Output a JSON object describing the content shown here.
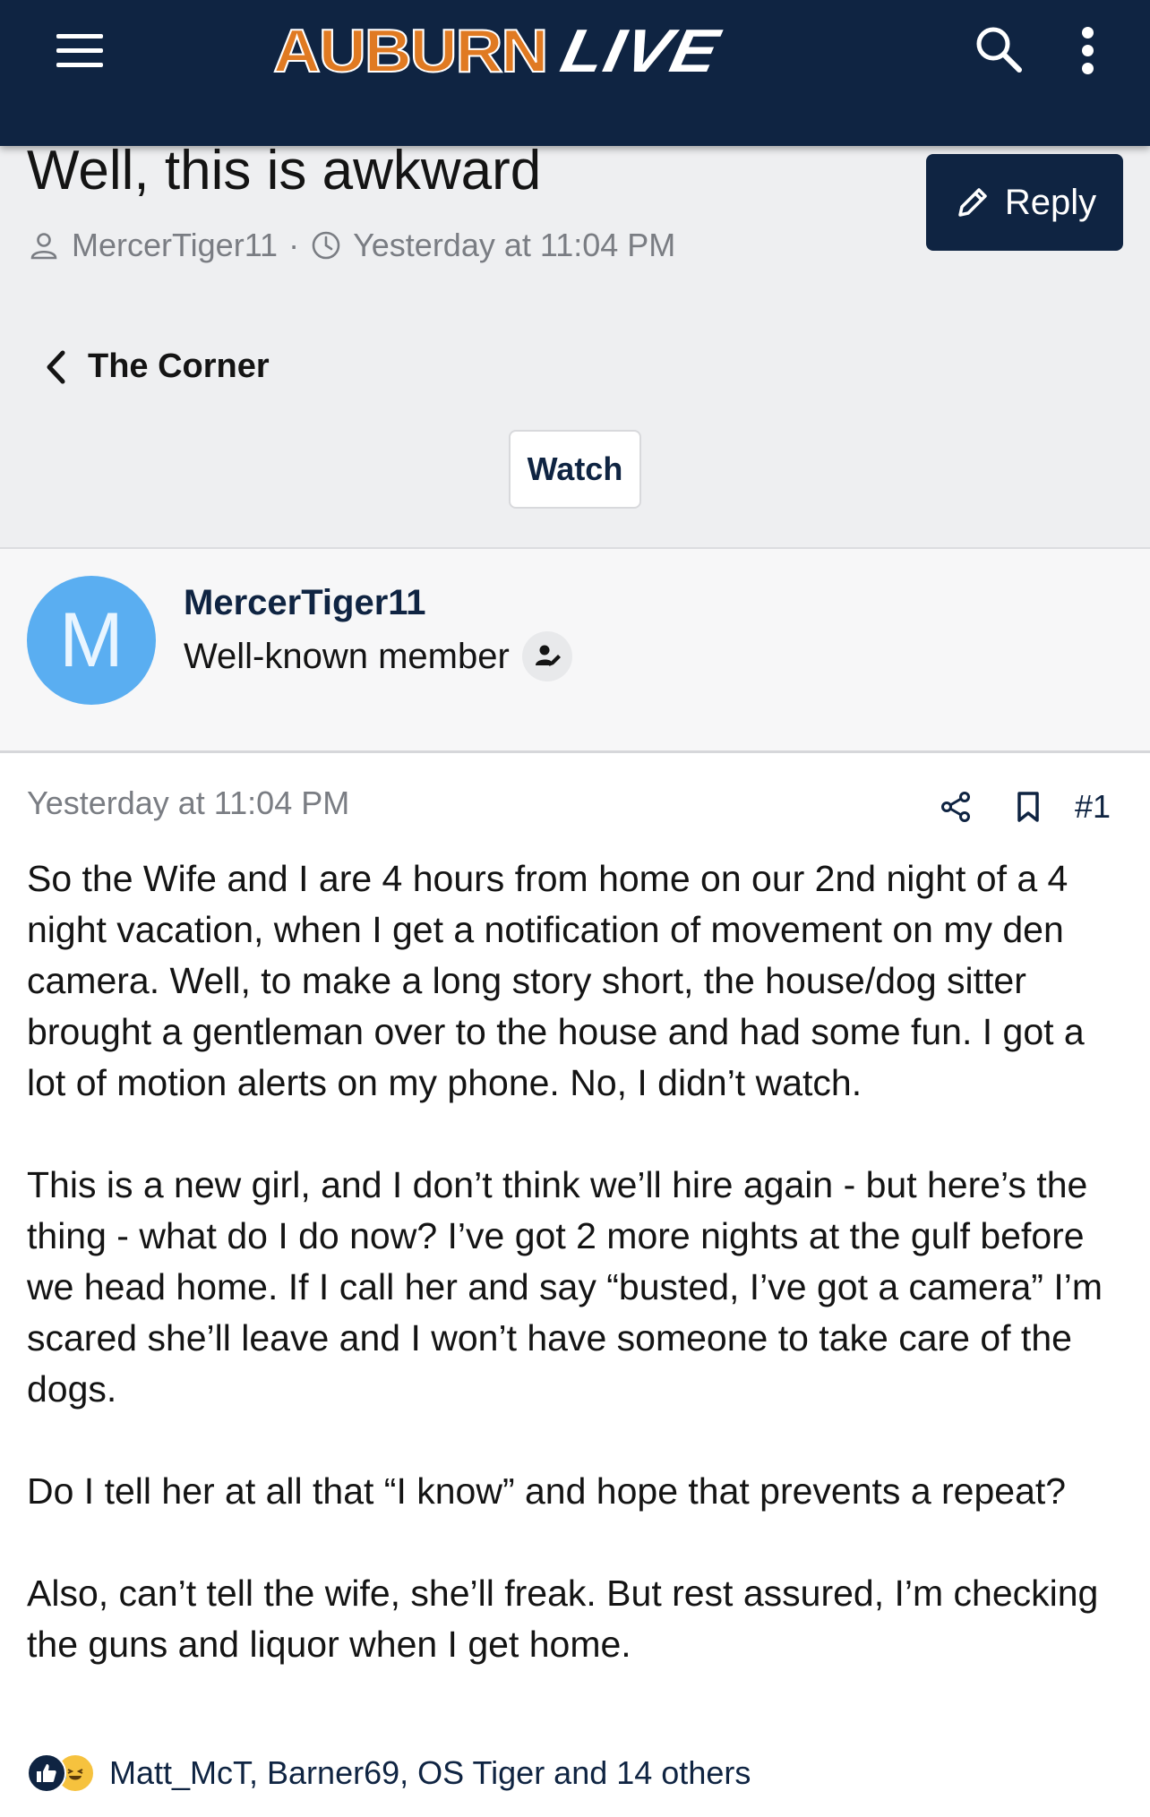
{
  "topbar": {
    "logo_part1": "AUBURN",
    "logo_part2": "LIVE",
    "menu_icon": "hamburger-menu-icon",
    "search_icon": "search-icon",
    "more_icon": "kebab-more-icon",
    "bg_color": "#0f2442",
    "accent_color": "#e07a22"
  },
  "thread": {
    "title": "Well, this is awkward",
    "author": "MercerTiger11",
    "separator": "·",
    "timestamp": "Yesterday at 11:04 PM",
    "reply_label": "Reply",
    "breadcrumb": "The Corner",
    "watch_label": "Watch"
  },
  "user": {
    "avatar_letter": "M",
    "avatar_color": "#5aaef1",
    "name": "MercerTiger11",
    "title": "Well-known member"
  },
  "post": {
    "date": "Yesterday at 11:04 PM",
    "number": "#1",
    "paragraphs": [
      "So the Wife and I are 4 hours from home on our 2nd night of a 4 night vacation, when I get a notification of movement on my den camera. Well, to make a long story short, the house/dog sitter brought a gentleman over to the house and had some fun. I got a lot of motion alerts on my phone. No, I didn’t watch.",
      "This is a new girl, and I don’t think we’ll hire again - but here’s the thing - what do I do now? I’ve got 2 more nights at the gulf before we head home. If I call her and say “busted, I’ve got a camera” I’m scared she’ll leave and I won’t have someone to take care of the dogs.",
      "Do I tell her at all that “I know” and hope that prevents a repeat?",
      "Also, can’t tell the wife, she’ll freak. But rest assured, I’m checking the guns and liquor when I get home."
    ],
    "reactions_text": "Matt_McT, Barner69, OS Tiger and 14 others"
  }
}
